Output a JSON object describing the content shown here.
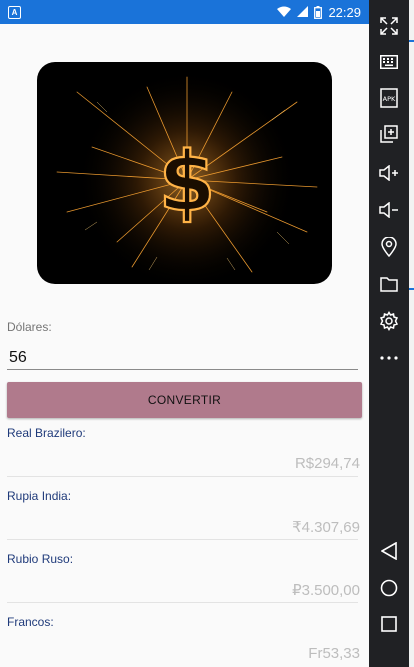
{
  "status_bar": {
    "time": "22:29",
    "notification_glyph": "A",
    "icons": [
      "wifi-icon",
      "signal-icon",
      "battery-icon"
    ],
    "color": "#1a73d9"
  },
  "hero": {
    "image": "sparkler-dollar-sign",
    "symbol": "$"
  },
  "form": {
    "amount_label": "Dólares:",
    "amount_value": "56",
    "convert_label": "CONVERTIR",
    "button_color": "#b07a8c"
  },
  "results": [
    {
      "label": "Real Brazilero:",
      "value": "R$294,74"
    },
    {
      "label": "Rupia India:",
      "value": "₹4.307,69"
    },
    {
      "label": "Rubio Ruso:",
      "value": "₽3.500,00"
    },
    {
      "label": "Francos:",
      "value": "Fr53,33"
    }
  ],
  "emulator_toolbar": {
    "buttons": [
      "fullscreen-icon",
      "keyboard-icon",
      "apk-icon",
      "screenshot-icon",
      "volume-up-icon",
      "volume-down-icon",
      "location-icon",
      "folder-icon",
      "settings-icon",
      "more-icon",
      "back-icon",
      "home-icon",
      "recents-icon"
    ],
    "apk_text": "APK"
  }
}
